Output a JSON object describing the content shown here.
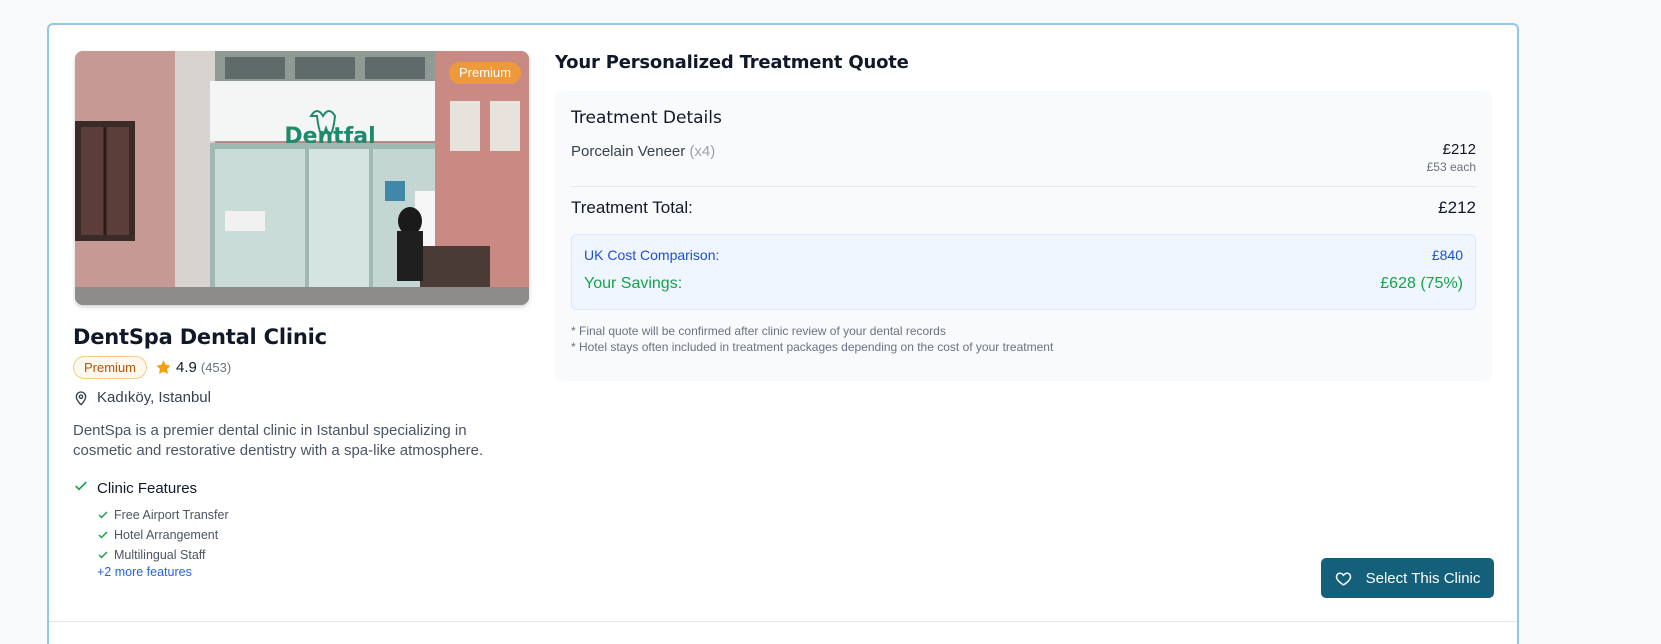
{
  "colors": {
    "accent": "#14607a",
    "card_border": "#93c5ed",
    "premium": "#ee9a3c",
    "savings": "#16a34a",
    "comparison": "#1d4ed8",
    "link": "#2563eb"
  },
  "clinic": {
    "image_badge": "Premium",
    "name": "DentSpa Dental Clinic",
    "tier_badge": "Premium",
    "rating": "4.9",
    "reviews": "(453)",
    "location": "Kadıköy, Istanbul",
    "description": "DentSpa is a premier dental clinic in Istanbul specializing in cosmetic and restorative dentistry with a spa-like atmosphere.",
    "features_title": "Clinic Features",
    "features": [
      "Free Airport Transfer",
      "Hotel Arrangement",
      "Multilingual Staff"
    ],
    "more_features": "+2 more features",
    "storefront_sign": "Dentfal",
    "icons": {
      "star": "star-icon",
      "location": "map-pin-icon",
      "check": "check-icon"
    }
  },
  "quote": {
    "title": "Your Personalized Treatment Quote",
    "details_title": "Treatment Details",
    "items": [
      {
        "name": "Porcelain Veneer",
        "qty": "(x4)",
        "price": "£212",
        "unit_price": "£53 each"
      }
    ],
    "total_label": "Treatment Total:",
    "total_value": "£212",
    "uk_label": "UK Cost Comparison:",
    "uk_value": "£840",
    "savings_label": "Your Savings:",
    "savings_value": "£628 (75%)",
    "notes": [
      "* Final quote will be confirmed after clinic review of your dental records",
      "* Hotel stays often included in treatment packages depending on the cost of your treatment"
    ]
  },
  "actions": {
    "select_label": "Select This Clinic",
    "select_icon": "heart-icon"
  }
}
